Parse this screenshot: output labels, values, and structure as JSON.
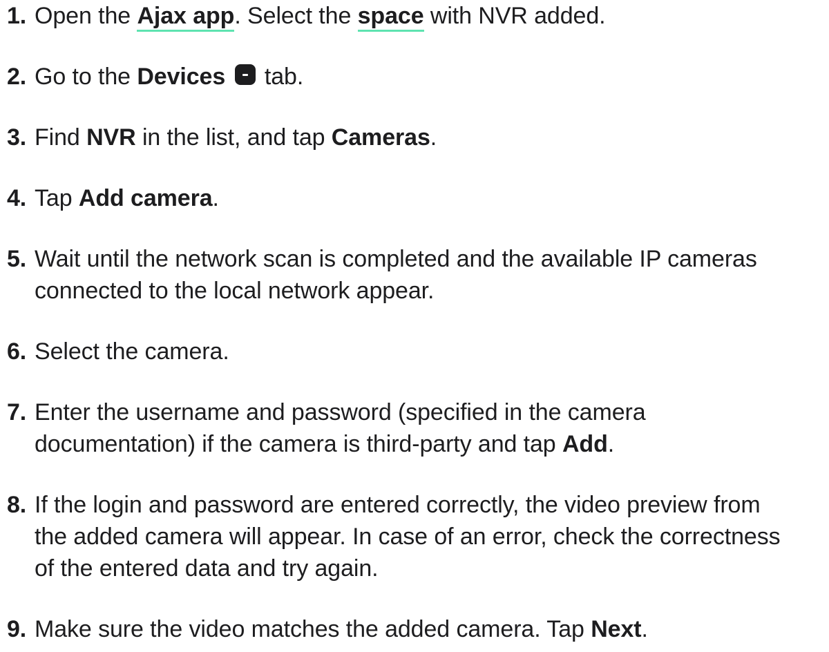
{
  "steps": [
    {
      "num": "1.",
      "parts": [
        {
          "t": "Open the "
        },
        {
          "t": "Ajax app",
          "link": true
        },
        {
          "t": ". Select the "
        },
        {
          "t": "space",
          "link": true
        },
        {
          "t": " with NVR added."
        }
      ]
    },
    {
      "num": "2.",
      "parts": [
        {
          "t": "Go to the "
        },
        {
          "t": "Devices",
          "b": true
        },
        {
          "t": " "
        },
        {
          "icon": "devices-icon"
        },
        {
          "t": " tab."
        }
      ]
    },
    {
      "num": "3.",
      "parts": [
        {
          "t": "Find "
        },
        {
          "t": "NVR",
          "b": true
        },
        {
          "t": " in the list, and tap "
        },
        {
          "t": "Cameras",
          "b": true
        },
        {
          "t": "."
        }
      ]
    },
    {
      "num": "4.",
      "parts": [
        {
          "t": "Tap "
        },
        {
          "t": "Add camera",
          "b": true
        },
        {
          "t": "."
        }
      ]
    },
    {
      "num": "5.",
      "lines": [
        [
          {
            "t": "Wait until the network scan is completed and the available IP cameras"
          }
        ],
        [
          {
            "t": "connected to the local network appear."
          }
        ]
      ]
    },
    {
      "num": "6.",
      "parts": [
        {
          "t": "Select the camera."
        }
      ]
    },
    {
      "num": "7.",
      "lines": [
        [
          {
            "t": "Enter the username and password (specified in the camera"
          }
        ],
        [
          {
            "t": "documentation) if the camera is third-party and tap "
          },
          {
            "t": "Add",
            "b": true
          },
          {
            "t": "."
          }
        ]
      ]
    },
    {
      "num": "8.",
      "lines": [
        [
          {
            "t": "If the login and password are entered correctly, the video preview from"
          }
        ],
        [
          {
            "t": "the added camera will appear. In case of an error, check the correctness"
          }
        ],
        [
          {
            "t": "of the entered data and try again."
          }
        ]
      ]
    },
    {
      "num": "9.",
      "parts": [
        {
          "t": "Make sure the video matches the added camera. Tap "
        },
        {
          "t": "Next",
          "b": true
        },
        {
          "t": "."
        }
      ]
    }
  ]
}
